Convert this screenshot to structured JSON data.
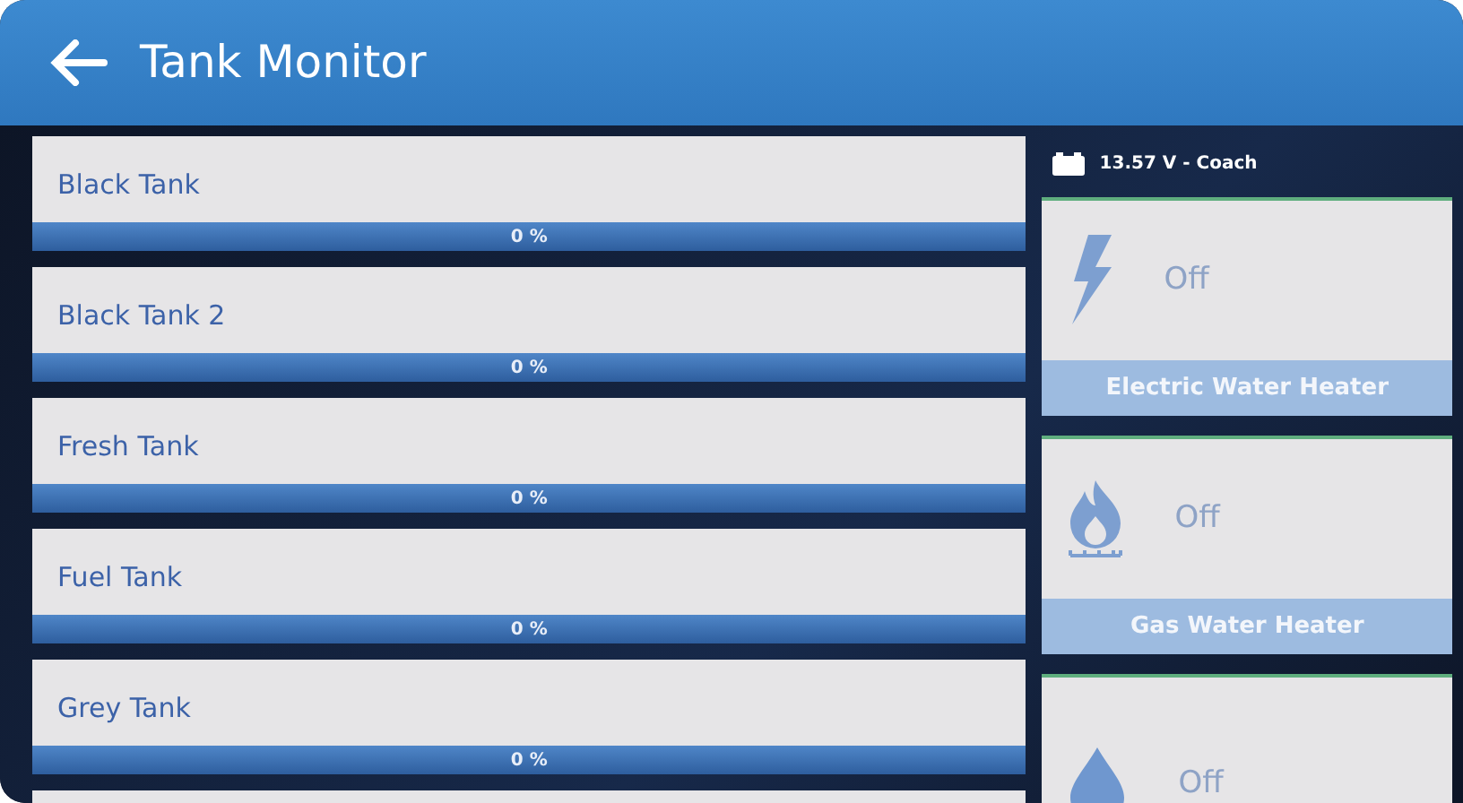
{
  "header": {
    "title": "Tank Monitor"
  },
  "tanks": [
    {
      "name": "Black Tank",
      "level": 0,
      "reading": "0 %"
    },
    {
      "name": "Black Tank 2",
      "level": 0,
      "reading": "0 %"
    },
    {
      "name": "Fresh Tank",
      "level": 0,
      "reading": "0 %"
    },
    {
      "name": "Fuel Tank",
      "level": 0,
      "reading": "0 %"
    },
    {
      "name": "Grey Tank",
      "level": 0,
      "reading": "0 %"
    }
  ],
  "battery": {
    "reading": "13.57 V - Coach"
  },
  "heaters": [
    {
      "kind": "electric",
      "status": "Off",
      "label": "Electric Water Heater"
    },
    {
      "kind": "gas",
      "status": "Off",
      "label": "Gas Water Heater"
    },
    {
      "kind": "water",
      "status": "Off"
    }
  ]
}
